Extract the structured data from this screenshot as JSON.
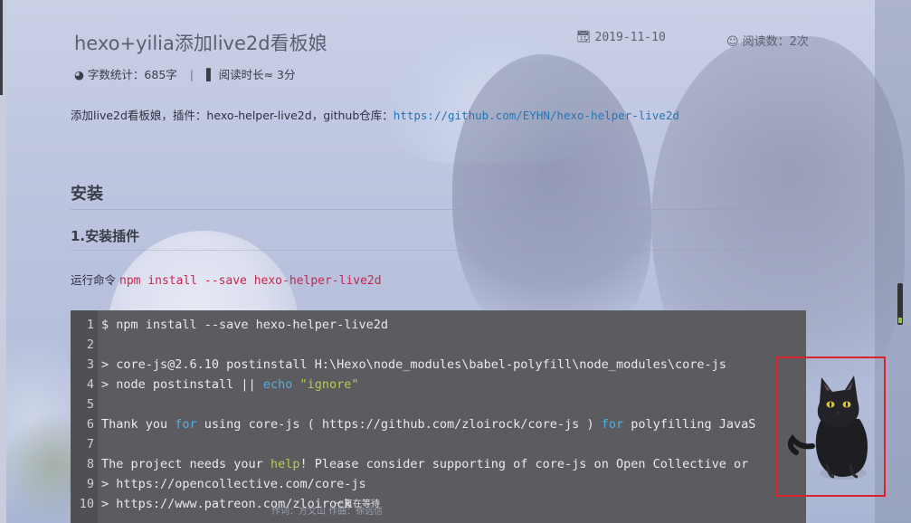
{
  "post": {
    "title": "hexo+yilia添加live2d看板娘",
    "date": "2019-11-10",
    "views": "阅读数：2次",
    "word_count": "字数统计：685字",
    "separator": "|",
    "read_time": "阅读时长≈ 3分",
    "intro_text": "添加live2d看板娘，插件：hexo-helper-live2d，github仓库：",
    "repo_link": "https://github.com/EYHN/hexo-helper-live2d",
    "h2_install": "安装",
    "h3_plugin": "1.安装插件",
    "run_label": "运行命令",
    "run_command": "npm install --save hexo-helper-live2d"
  },
  "icons": {
    "calendar": "calendar-icon",
    "eye": "eye-icon",
    "pie": "pie-chart-icon",
    "book": "book-icon"
  },
  "code": {
    "lines": [
      {
        "n": "1",
        "text": "$ npm install --save hexo-helper-live2d"
      },
      {
        "n": "2",
        "text": ""
      },
      {
        "n": "3",
        "text": "> core-js@2.6.10 postinstall H:\\Hexo\\node_modules\\babel-polyfill\\node_modules\\core-js"
      },
      {
        "n": "4",
        "pre": "> node postinstall || ",
        "kw": "echo",
        "mid": " ",
        "str": "\"ignore\""
      },
      {
        "n": "5",
        "text": ""
      },
      {
        "n": "6",
        "pre": "Thank you ",
        "kw": "for",
        "mid": " using core-js ( https://github.com/zloirock/core-js ) ",
        "kw2": "for",
        "post": " polyfilling JavaS"
      },
      {
        "n": "7",
        "text": ""
      },
      {
        "n": "8",
        "pre": "The project needs your ",
        "str": "help",
        "post": "! Please consider supporting of core-js on Open Collective or"
      },
      {
        "n": "9",
        "text": "> https://opencollective.com/core-js"
      },
      {
        "n": "10",
        "text": "> https://www.patreon.com/zloirock"
      }
    ]
  },
  "footer": {
    "line1": "作词：方文山 作曲：徐远信",
    "line2": "一直在等待"
  },
  "colors": {
    "code_bg": "#5b5b60",
    "keyword": "#4fb0e8",
    "string": "#b5cf4b",
    "inline_code": "#c7254e",
    "link": "#2576b5",
    "highlight_box": "#d8232a"
  }
}
